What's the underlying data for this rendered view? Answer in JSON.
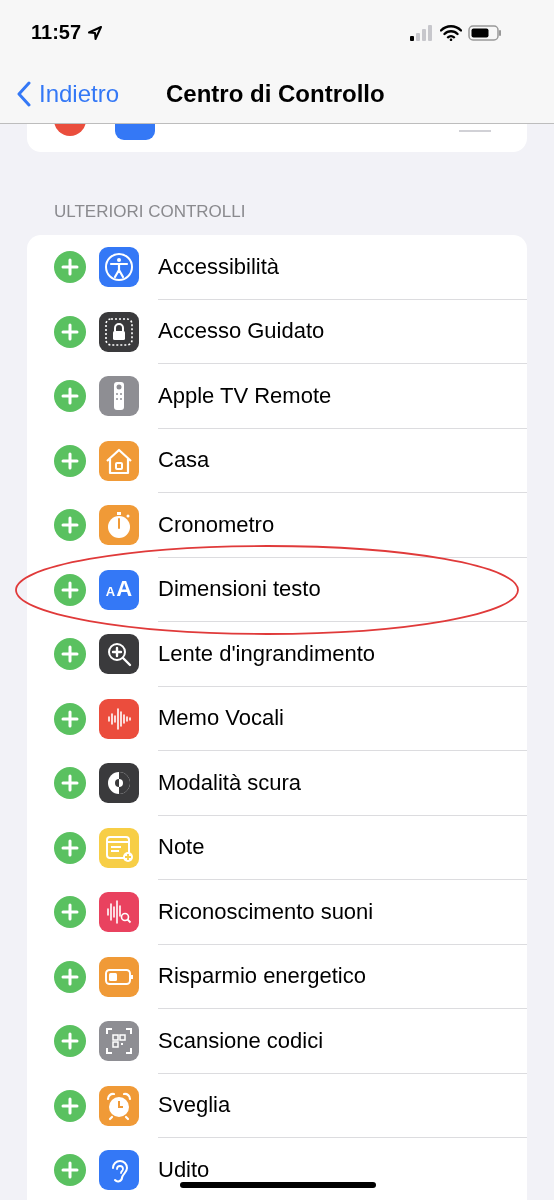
{
  "status_bar": {
    "time": "11:57"
  },
  "nav": {
    "back": "Indietro",
    "title": "Centro di Controllo"
  },
  "top_card_tail": {
    "color": "#3478f6"
  },
  "section": {
    "header": "ULTERIORI CONTROLLI",
    "rows": [
      {
        "label": "Accessibilità",
        "color": "#3478f6",
        "highlighted": false
      },
      {
        "label": "Accesso Guidato",
        "color": "#3a3a3c",
        "highlighted": false
      },
      {
        "label": "Apple TV Remote",
        "color": "#8e8e93",
        "highlighted": false
      },
      {
        "label": "Casa",
        "color": "#f09a37",
        "highlighted": false
      },
      {
        "label": "Cronometro",
        "color": "#f09a37",
        "highlighted": false
      },
      {
        "label": "Dimensioni testo",
        "color": "#3478f6",
        "highlighted": true,
        "icon_text": "AA"
      },
      {
        "label": "Lente d'ingrandimento",
        "color": "#3a3a3c",
        "highlighted": false
      },
      {
        "label": "Memo Vocali",
        "color": "#eb4d3d",
        "highlighted": false
      },
      {
        "label": "Modalità scura",
        "color": "#3a3a3c",
        "highlighted": false
      },
      {
        "label": "Note",
        "color": "#f7ce46",
        "highlighted": false
      },
      {
        "label": "Riconoscimento suoni",
        "color": "#e9425f",
        "highlighted": false
      },
      {
        "label": "Risparmio energetico",
        "color": "#f09a37",
        "highlighted": false
      },
      {
        "label": "Scansione codici",
        "color": "#8e8e93",
        "highlighted": false
      },
      {
        "label": "Sveglia",
        "color": "#f09a37",
        "highlighted": false
      },
      {
        "label": "Udito",
        "color": "#3478f6",
        "highlighted": false
      }
    ]
  }
}
